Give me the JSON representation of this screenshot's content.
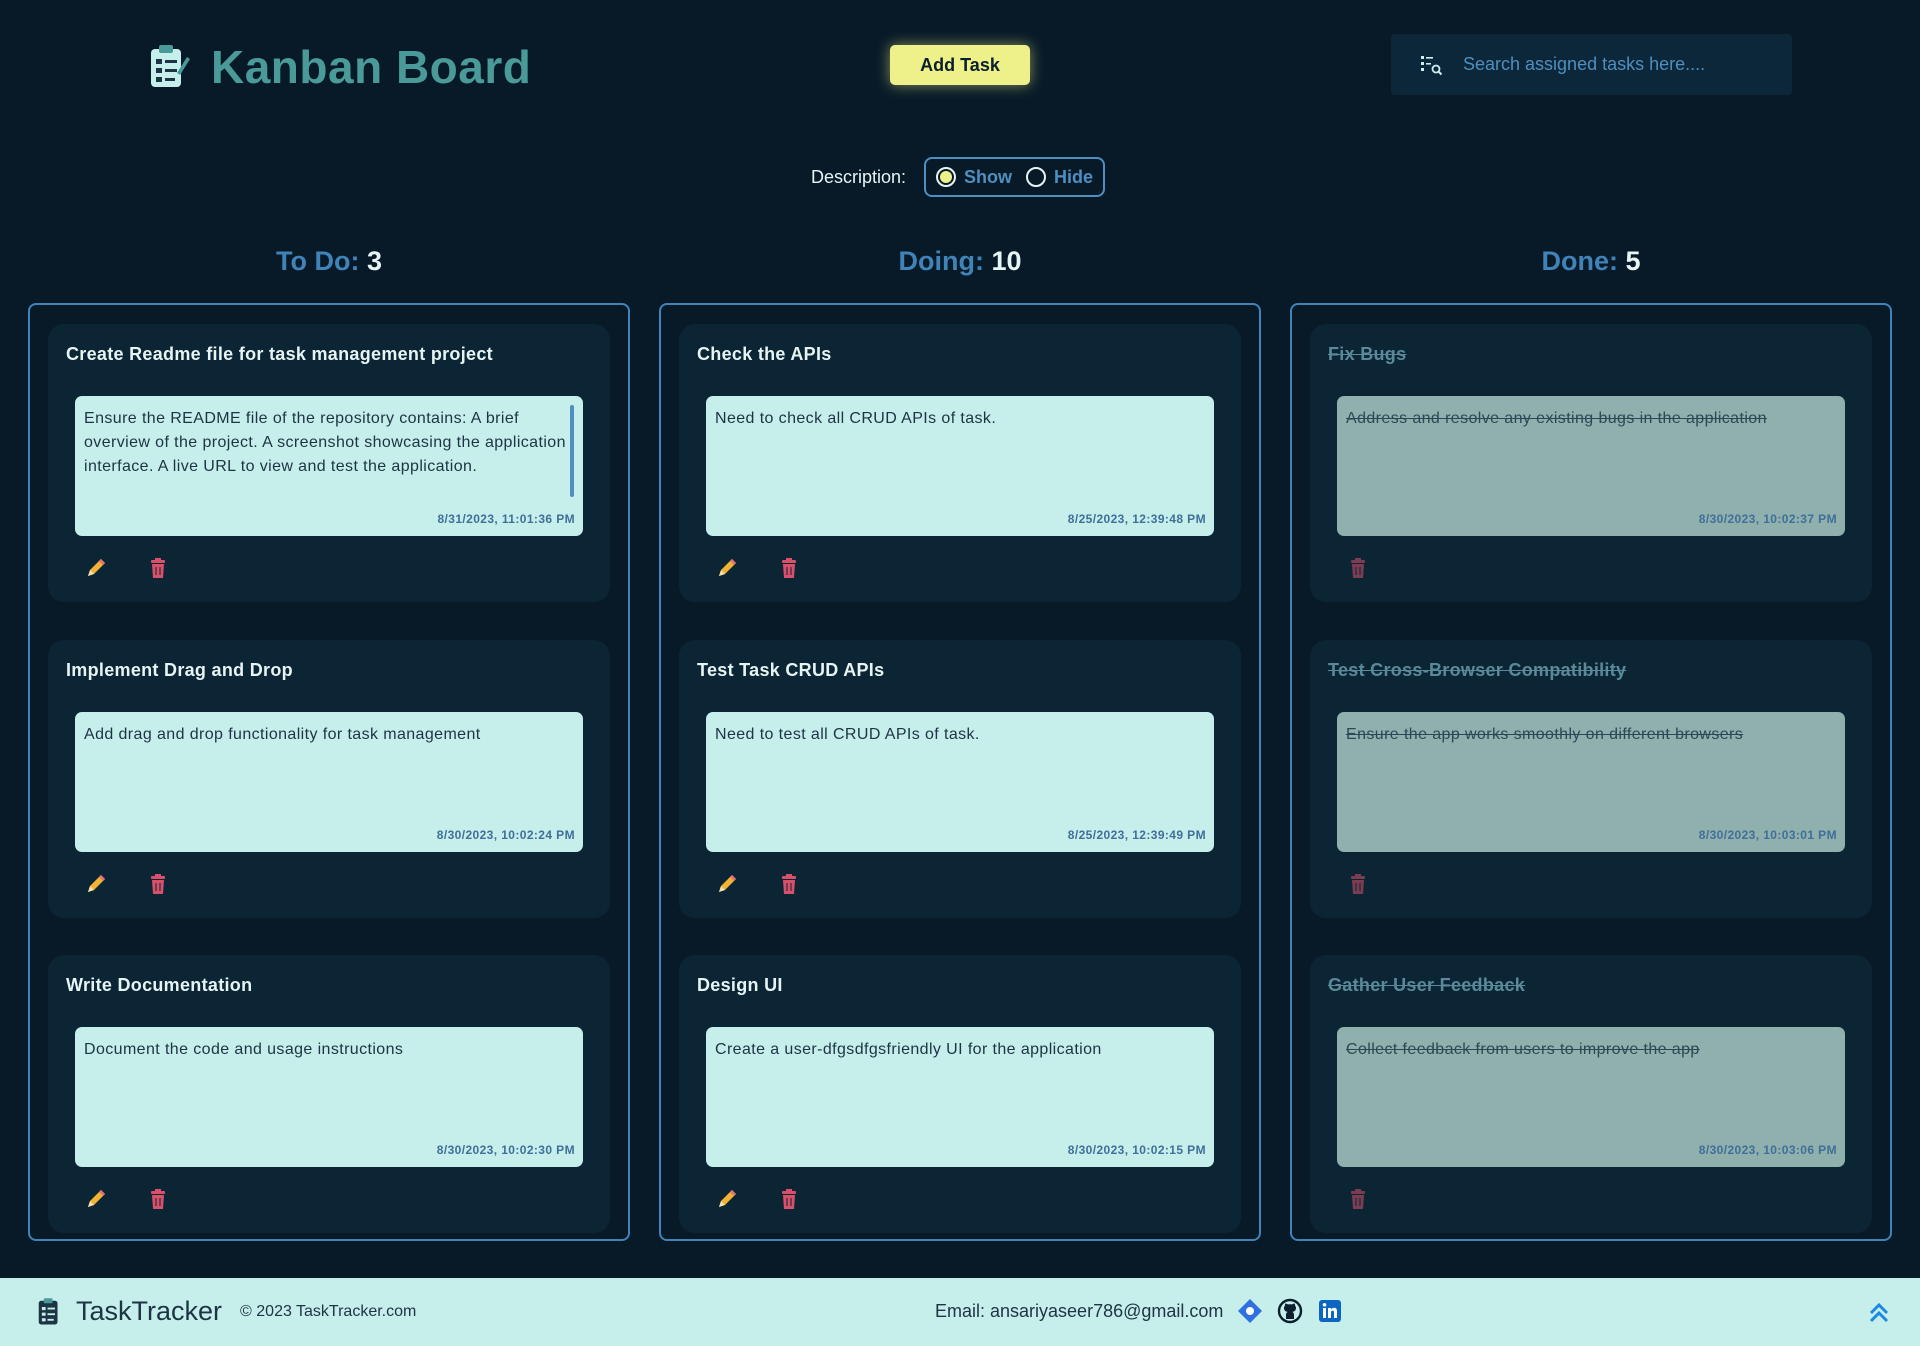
{
  "header": {
    "title": "Kanban Board",
    "add_task_label": "Add Task",
    "search_placeholder": "Search assigned tasks here...."
  },
  "description_toggle": {
    "label": "Description:",
    "show_label": "Show",
    "hide_label": "Hide",
    "selected": "Show"
  },
  "columns": [
    {
      "name": "To Do:",
      "count": "3",
      "cards": [
        {
          "title": "Create Readme file for task management project",
          "description": "Ensure the README file of the repository contains: A brief overview of the project. A screenshot showcasing the application interface. A live URL to view and test the application.",
          "timestamp": "8/31/2023, 11:01:36 PM"
        },
        {
          "title": "Implement Drag and Drop",
          "description": "Add drag and drop functionality for task management",
          "timestamp": "8/30/2023, 10:02:24 PM"
        },
        {
          "title": "Write Documentation",
          "description": "Document the code and usage instructions",
          "timestamp": "8/30/2023, 10:02:30 PM"
        }
      ]
    },
    {
      "name": "Doing:",
      "count": "10",
      "cards": [
        {
          "title": "Check the APIs",
          "description": "Need to check all CRUD APIs of task.",
          "timestamp": "8/25/2023, 12:39:48 PM"
        },
        {
          "title": "Test Task CRUD APIs",
          "description": "Need to test all CRUD APIs of task.",
          "timestamp": "8/25/2023, 12:39:49 PM"
        },
        {
          "title": "Design UI",
          "description": "Create a user-dfgsdfgsfriendly UI for the application",
          "timestamp": "8/30/2023, 10:02:15 PM"
        }
      ]
    },
    {
      "name": "Done:",
      "count": "5",
      "cards": [
        {
          "title": "Fix Bugs",
          "description": "Address and resolve any existing bugs in the application",
          "timestamp": "8/30/2023, 10:02:37 PM"
        },
        {
          "title": "Test Cross-Browser Compatibility",
          "description": "Ensure the app works smoothly on different browsers",
          "timestamp": "8/30/2023, 10:03:01 PM"
        },
        {
          "title": "Gather User Feedback",
          "description": "Collect feedback from users to improve the app",
          "timestamp": "8/30/2023, 10:03:06 PM"
        }
      ]
    }
  ],
  "footer": {
    "brand": "TaskTracker",
    "copyright": "© 2023 TaskTracker.com",
    "email": "Email: ansariyaseer786@gmail.com"
  },
  "icons": {
    "logo": "clipboard-icon",
    "search": "search-list-icon",
    "edit": "pencil-icon",
    "delete": "trash-icon",
    "portfolio": "portfolio-icon",
    "github": "github-icon",
    "linkedin": "linkedin-icon",
    "scroll_top": "double-chevron-up-icon"
  },
  "colors": {
    "background": "#081a28",
    "accent_yellow": "#eef08a",
    "accent_blue": "#3f83b8",
    "card_desc": "#c6eeea",
    "done_desc": "#8fb0ad",
    "delete_red": "#d9506a"
  }
}
